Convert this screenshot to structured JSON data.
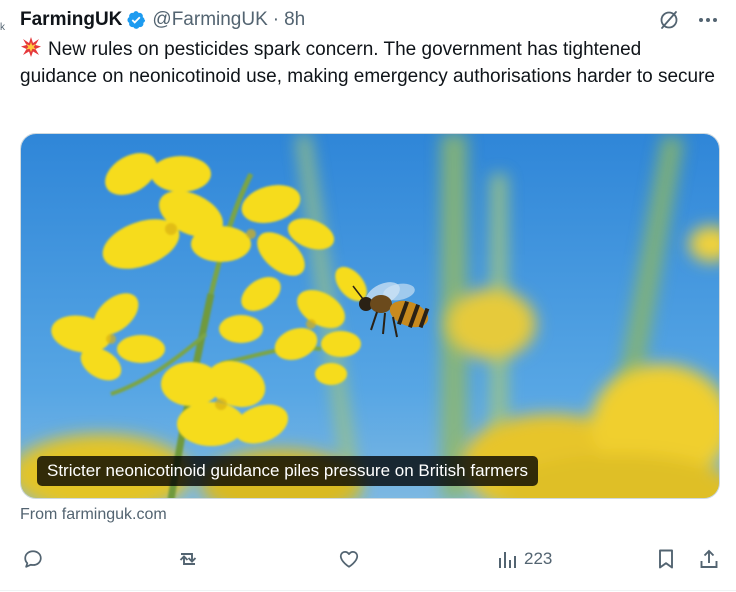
{
  "edge_glyph": "k",
  "post": {
    "author_name": "FarmingUK",
    "verified": true,
    "handle": "@FarmingUK",
    "separator": "·",
    "time": "8h",
    "emoji": "collision",
    "text": "New rules on pesticides spark concern. The government has tightened guidance on neonicotinoid use, making emergency authorisations harder to secure",
    "media": {
      "caption": "Stricter neonicotinoid guidance piles pressure on British farmers",
      "description_icon": "bee-on-rapeseed-photo"
    },
    "source": "From farminguk.com",
    "metrics": {
      "views": "223"
    }
  },
  "colors": {
    "text": "#0f1419",
    "secondary": "#536471",
    "verified": "#1d9bf0",
    "sky": "#3f8fd6",
    "rapeseed": "#f2d21b"
  }
}
